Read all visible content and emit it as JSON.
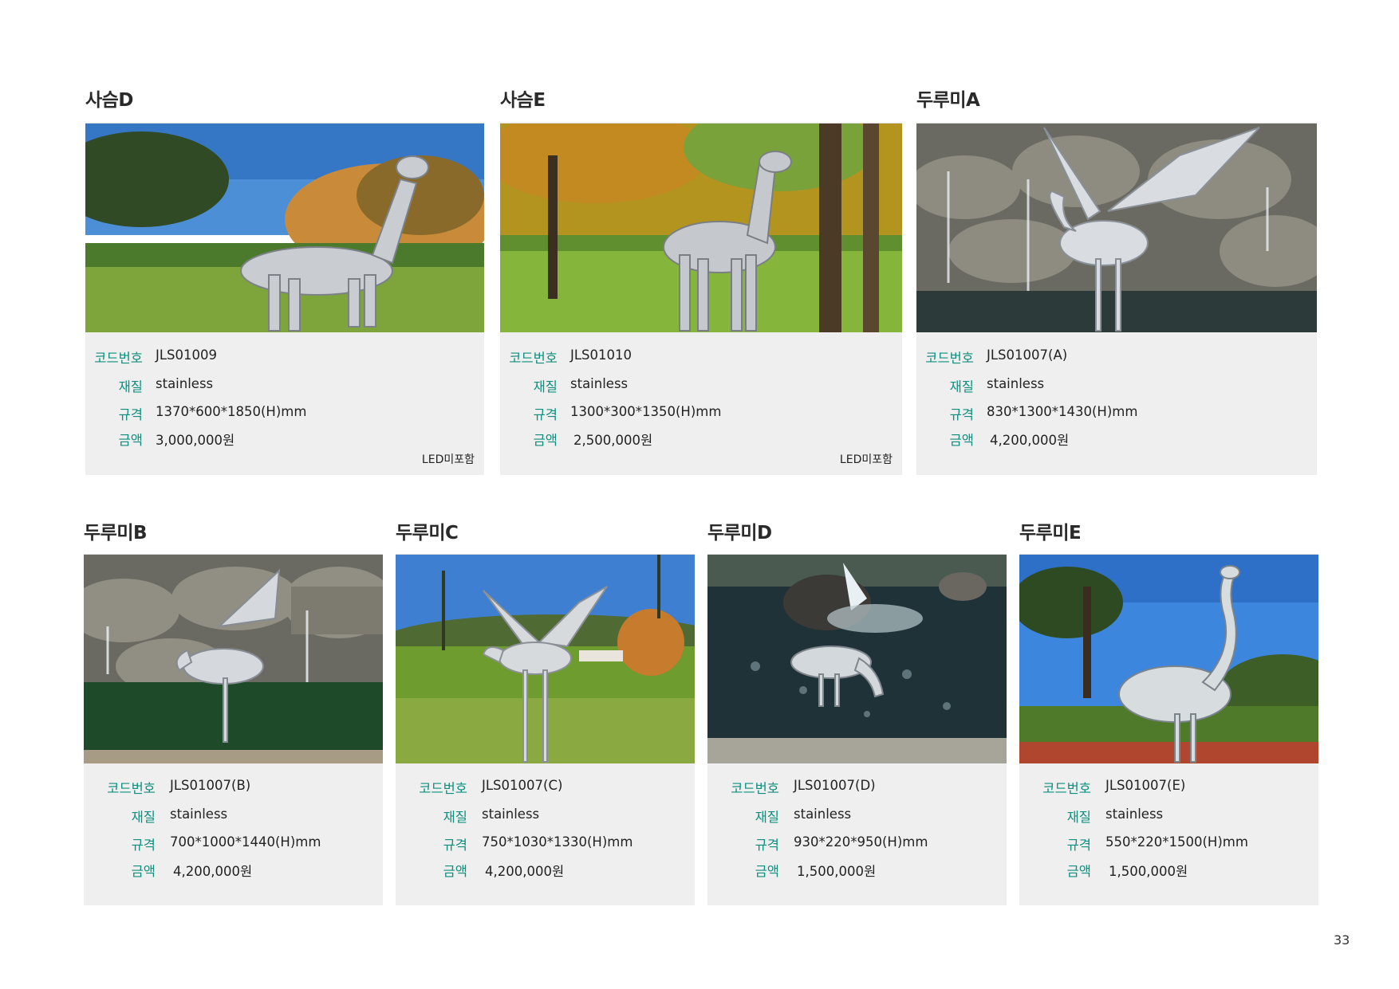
{
  "labels": {
    "code": "코드번호",
    "material": "재질",
    "spec": "규격",
    "price": "금액"
  },
  "note": "LED미포함",
  "page_number": "33",
  "products": [
    {
      "name": "사슴D",
      "code": "JLS01009",
      "material": "stainless",
      "spec": "1370*600*1850(H)mm",
      "price": "3,000,000원",
      "note": "LED미포함",
      "photo": "deer-sculpture-photo"
    },
    {
      "name": "사슴E",
      "code": "JLS01010",
      "material": "stainless",
      "spec": "1300*300*1350(H)mm",
      "price": "2,500,000원",
      "note": "LED미포함",
      "photo": "deer-sculpture-photo"
    },
    {
      "name": "두루미A",
      "code": "JLS01007(A)",
      "material": "stainless",
      "spec": "830*1300*1430(H)mm",
      "price": "4,200,000원",
      "photo": "crane-fountain-photo"
    },
    {
      "name": "두루미B",
      "code": "JLS01007(B)",
      "material": "stainless",
      "spec": "700*1000*1440(H)mm",
      "price": "4,200,000원",
      "photo": "crane-fountain-photo"
    },
    {
      "name": "두루미C",
      "code": "JLS01007(C)",
      "material": "stainless",
      "spec": "750*1030*1330(H)mm",
      "price": "4,200,000원",
      "photo": "crane-lawn-photo"
    },
    {
      "name": "두루미D",
      "code": "JLS01007(D)",
      "material": "stainless",
      "spec": "930*220*950(H)mm",
      "price": "1,500,000원",
      "photo": "crane-pond-photo"
    },
    {
      "name": "두루미E",
      "code": "JLS01007(E)",
      "material": "stainless",
      "spec": "550*220*1500(H)mm",
      "price": "1,500,000원",
      "photo": "crane-sky-photo"
    }
  ]
}
